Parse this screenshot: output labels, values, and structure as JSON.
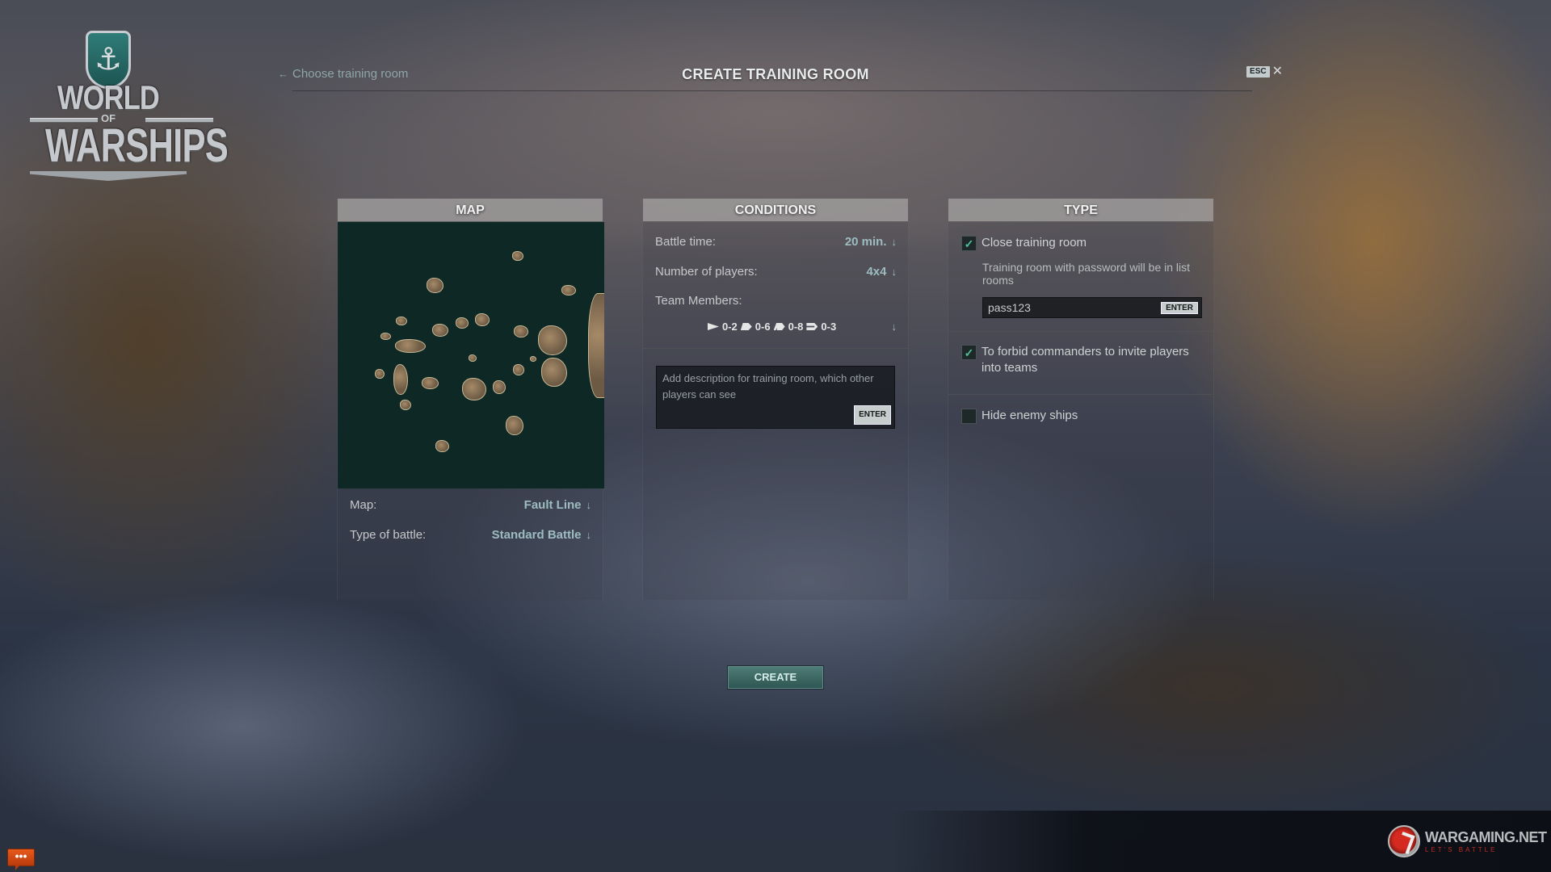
{
  "logo": {
    "line1": "WORLD",
    "line2": "OF",
    "line3": "WARSHIPS",
    "emblem": "anchor-shield-icon"
  },
  "header": {
    "back_label": "Choose training room",
    "back_icon": "arrow-left-icon",
    "title": "CREATE TRAINING ROOM",
    "esc_label": "ESC",
    "close_icon": "close-x-icon"
  },
  "map_panel": {
    "title": "MAP",
    "preview_alt": "Fault Line map preview",
    "fields": [
      {
        "label": "Map:",
        "value": "Fault Line"
      },
      {
        "label": "Type of battle:",
        "value": "Standard Battle"
      }
    ]
  },
  "conditions_panel": {
    "title": "CONDITIONS",
    "fields": [
      {
        "label": "Battle time:",
        "value": "20 min."
      },
      {
        "label": "Number of players:",
        "value": "4x4"
      }
    ],
    "team_members_label": "Team Members:",
    "team_limits": [
      {
        "class": "destroyer",
        "icon": "destroyer-icon",
        "range": "0-2"
      },
      {
        "class": "cruiser",
        "icon": "cruiser-icon",
        "range": "0-6"
      },
      {
        "class": "battleship",
        "icon": "battleship-icon",
        "range": "0-8"
      },
      {
        "class": "aircraft-carrier",
        "icon": "aircraft-carrier-icon",
        "range": "0-3"
      }
    ],
    "description": {
      "placeholder": "Add description for training room, which other players can see",
      "value": "",
      "enter_label": "ENTER"
    }
  },
  "type_panel": {
    "title": "TYPE",
    "close_room": {
      "label": "Close training room",
      "checked": true
    },
    "password_hint": "Training room with password will be in list rooms",
    "password": {
      "value": "pass123",
      "enter_label": "ENTER"
    },
    "forbid_invites": {
      "label": "To forbid commanders to invite players into teams",
      "checked": true
    },
    "hide_enemy": {
      "label": "Hide enemy ships",
      "checked": false
    }
  },
  "actions": {
    "create_label": "CREATE"
  },
  "footer": {
    "brand": "WARGAMING.NET",
    "tagline": "LET'S BATTLE",
    "chat_label": "•••"
  },
  "colors": {
    "accent_value": "#9dbcc0",
    "check_green": "#4fbf9b",
    "create_button": "#3f6b66",
    "map_water": "#0e2826",
    "chat_orange": "#d84a14",
    "brand_red": "#c02a22"
  }
}
